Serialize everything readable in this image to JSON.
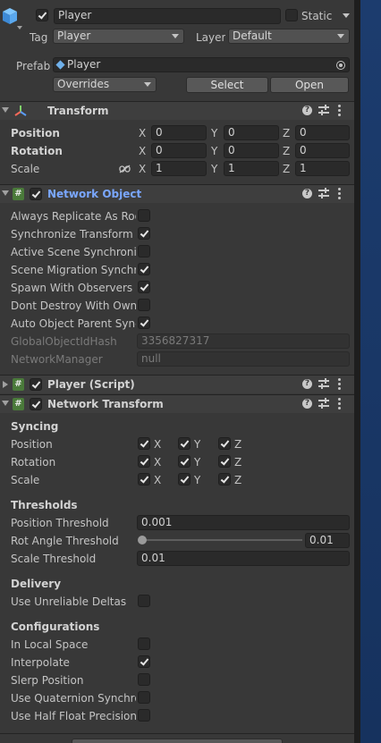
{
  "gameobject": {
    "name": "Player",
    "static_label": "Static",
    "tag_label": "Tag",
    "tag_value": "Player",
    "layer_label": "Layer",
    "layer_value": "Default",
    "prefab_label": "Prefab",
    "prefab_value": "Player",
    "overrides_label": "Overrides",
    "select_label": "Select",
    "open_label": "Open"
  },
  "transform": {
    "title": "Transform",
    "position_label": "Position",
    "rotation_label": "Rotation",
    "scale_label": "Scale",
    "axes": [
      "X",
      "Y",
      "Z"
    ],
    "position": [
      "0",
      "0",
      "0"
    ],
    "rotation": [
      "0",
      "0",
      "0"
    ],
    "scale": [
      "1",
      "1",
      "1"
    ]
  },
  "network_object": {
    "title": "Network Object",
    "rows": [
      {
        "label": "Always Replicate As Roo",
        "checked": false
      },
      {
        "label": "Synchronize Transform",
        "checked": true
      },
      {
        "label": "Active Scene Synchroniz",
        "checked": false
      },
      {
        "label": "Scene Migration Synchro",
        "checked": true
      },
      {
        "label": "Spawn With Observers",
        "checked": true
      },
      {
        "label": "Dont Destroy With Owner",
        "checked": false
      },
      {
        "label": "Auto Object Parent Sync",
        "checked": true
      }
    ],
    "hash_label": "GlobalObjectIdHash",
    "hash_value": "3356827317",
    "manager_label": "NetworkManager",
    "manager_value": "null"
  },
  "player_script": {
    "title": "Player (Script)"
  },
  "network_transform": {
    "title": "Network Transform",
    "syncing_header": "Syncing",
    "sync_rows": [
      {
        "label": "Position",
        "x": true,
        "y": true,
        "z": true
      },
      {
        "label": "Rotation",
        "x": true,
        "y": true,
        "z": true
      },
      {
        "label": "Scale",
        "x": true,
        "y": true,
        "z": true
      }
    ],
    "axis_x": "X",
    "axis_y": "Y",
    "axis_z": "Z",
    "thresholds_header": "Thresholds",
    "position_threshold_label": "Position Threshold",
    "position_threshold": "0.001",
    "rot_angle_label": "Rot Angle Threshold",
    "rot_angle_value": "0.01",
    "rot_angle_fraction": 0.0,
    "scale_threshold_label": "Scale Threshold",
    "scale_threshold": "0.01",
    "delivery_header": "Delivery",
    "unreliable_label": "Use Unreliable Deltas",
    "unreliable_checked": false,
    "config_header": "Configurations",
    "config_rows": [
      {
        "label": "In Local Space",
        "checked": false
      },
      {
        "label": "Interpolate",
        "checked": true
      },
      {
        "label": "Slerp Position",
        "checked": false
      },
      {
        "label": "Use Quaternion Synchror",
        "checked": false
      },
      {
        "label": "Use Half Float Precision",
        "checked": false
      }
    ]
  },
  "colors": {
    "accent_blue": "#7aa7ff",
    "header_bg": "#3e3e3e",
    "panel_bg": "#383838"
  }
}
